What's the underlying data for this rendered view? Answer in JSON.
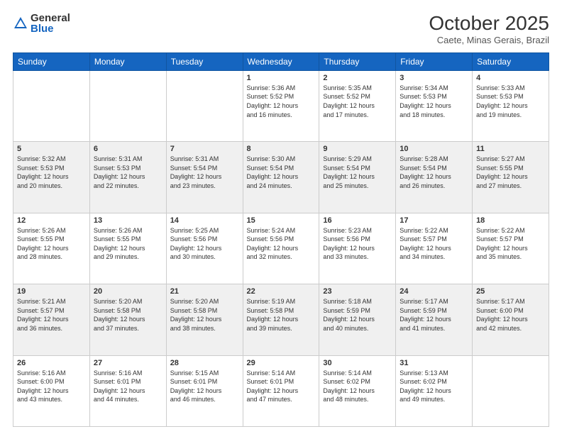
{
  "logo": {
    "general": "General",
    "blue": "Blue"
  },
  "header": {
    "month": "October 2025",
    "location": "Caete, Minas Gerais, Brazil"
  },
  "days_of_week": [
    "Sunday",
    "Monday",
    "Tuesday",
    "Wednesday",
    "Thursday",
    "Friday",
    "Saturday"
  ],
  "weeks": [
    [
      {
        "day": "",
        "info": ""
      },
      {
        "day": "",
        "info": ""
      },
      {
        "day": "",
        "info": ""
      },
      {
        "day": "1",
        "info": "Sunrise: 5:36 AM\nSunset: 5:52 PM\nDaylight: 12 hours\nand 16 minutes."
      },
      {
        "day": "2",
        "info": "Sunrise: 5:35 AM\nSunset: 5:52 PM\nDaylight: 12 hours\nand 17 minutes."
      },
      {
        "day": "3",
        "info": "Sunrise: 5:34 AM\nSunset: 5:53 PM\nDaylight: 12 hours\nand 18 minutes."
      },
      {
        "day": "4",
        "info": "Sunrise: 5:33 AM\nSunset: 5:53 PM\nDaylight: 12 hours\nand 19 minutes."
      }
    ],
    [
      {
        "day": "5",
        "info": "Sunrise: 5:32 AM\nSunset: 5:53 PM\nDaylight: 12 hours\nand 20 minutes."
      },
      {
        "day": "6",
        "info": "Sunrise: 5:31 AM\nSunset: 5:53 PM\nDaylight: 12 hours\nand 22 minutes."
      },
      {
        "day": "7",
        "info": "Sunrise: 5:31 AM\nSunset: 5:54 PM\nDaylight: 12 hours\nand 23 minutes."
      },
      {
        "day": "8",
        "info": "Sunrise: 5:30 AM\nSunset: 5:54 PM\nDaylight: 12 hours\nand 24 minutes."
      },
      {
        "day": "9",
        "info": "Sunrise: 5:29 AM\nSunset: 5:54 PM\nDaylight: 12 hours\nand 25 minutes."
      },
      {
        "day": "10",
        "info": "Sunrise: 5:28 AM\nSunset: 5:54 PM\nDaylight: 12 hours\nand 26 minutes."
      },
      {
        "day": "11",
        "info": "Sunrise: 5:27 AM\nSunset: 5:55 PM\nDaylight: 12 hours\nand 27 minutes."
      }
    ],
    [
      {
        "day": "12",
        "info": "Sunrise: 5:26 AM\nSunset: 5:55 PM\nDaylight: 12 hours\nand 28 minutes."
      },
      {
        "day": "13",
        "info": "Sunrise: 5:26 AM\nSunset: 5:55 PM\nDaylight: 12 hours\nand 29 minutes."
      },
      {
        "day": "14",
        "info": "Sunrise: 5:25 AM\nSunset: 5:56 PM\nDaylight: 12 hours\nand 30 minutes."
      },
      {
        "day": "15",
        "info": "Sunrise: 5:24 AM\nSunset: 5:56 PM\nDaylight: 12 hours\nand 32 minutes."
      },
      {
        "day": "16",
        "info": "Sunrise: 5:23 AM\nSunset: 5:56 PM\nDaylight: 12 hours\nand 33 minutes."
      },
      {
        "day": "17",
        "info": "Sunrise: 5:22 AM\nSunset: 5:57 PM\nDaylight: 12 hours\nand 34 minutes."
      },
      {
        "day": "18",
        "info": "Sunrise: 5:22 AM\nSunset: 5:57 PM\nDaylight: 12 hours\nand 35 minutes."
      }
    ],
    [
      {
        "day": "19",
        "info": "Sunrise: 5:21 AM\nSunset: 5:57 PM\nDaylight: 12 hours\nand 36 minutes."
      },
      {
        "day": "20",
        "info": "Sunrise: 5:20 AM\nSunset: 5:58 PM\nDaylight: 12 hours\nand 37 minutes."
      },
      {
        "day": "21",
        "info": "Sunrise: 5:20 AM\nSunset: 5:58 PM\nDaylight: 12 hours\nand 38 minutes."
      },
      {
        "day": "22",
        "info": "Sunrise: 5:19 AM\nSunset: 5:58 PM\nDaylight: 12 hours\nand 39 minutes."
      },
      {
        "day": "23",
        "info": "Sunrise: 5:18 AM\nSunset: 5:59 PM\nDaylight: 12 hours\nand 40 minutes."
      },
      {
        "day": "24",
        "info": "Sunrise: 5:17 AM\nSunset: 5:59 PM\nDaylight: 12 hours\nand 41 minutes."
      },
      {
        "day": "25",
        "info": "Sunrise: 5:17 AM\nSunset: 6:00 PM\nDaylight: 12 hours\nand 42 minutes."
      }
    ],
    [
      {
        "day": "26",
        "info": "Sunrise: 5:16 AM\nSunset: 6:00 PM\nDaylight: 12 hours\nand 43 minutes."
      },
      {
        "day": "27",
        "info": "Sunrise: 5:16 AM\nSunset: 6:01 PM\nDaylight: 12 hours\nand 44 minutes."
      },
      {
        "day": "28",
        "info": "Sunrise: 5:15 AM\nSunset: 6:01 PM\nDaylight: 12 hours\nand 46 minutes."
      },
      {
        "day": "29",
        "info": "Sunrise: 5:14 AM\nSunset: 6:01 PM\nDaylight: 12 hours\nand 47 minutes."
      },
      {
        "day": "30",
        "info": "Sunrise: 5:14 AM\nSunset: 6:02 PM\nDaylight: 12 hours\nand 48 minutes."
      },
      {
        "day": "31",
        "info": "Sunrise: 5:13 AM\nSunset: 6:02 PM\nDaylight: 12 hours\nand 49 minutes."
      },
      {
        "day": "",
        "info": ""
      }
    ]
  ]
}
